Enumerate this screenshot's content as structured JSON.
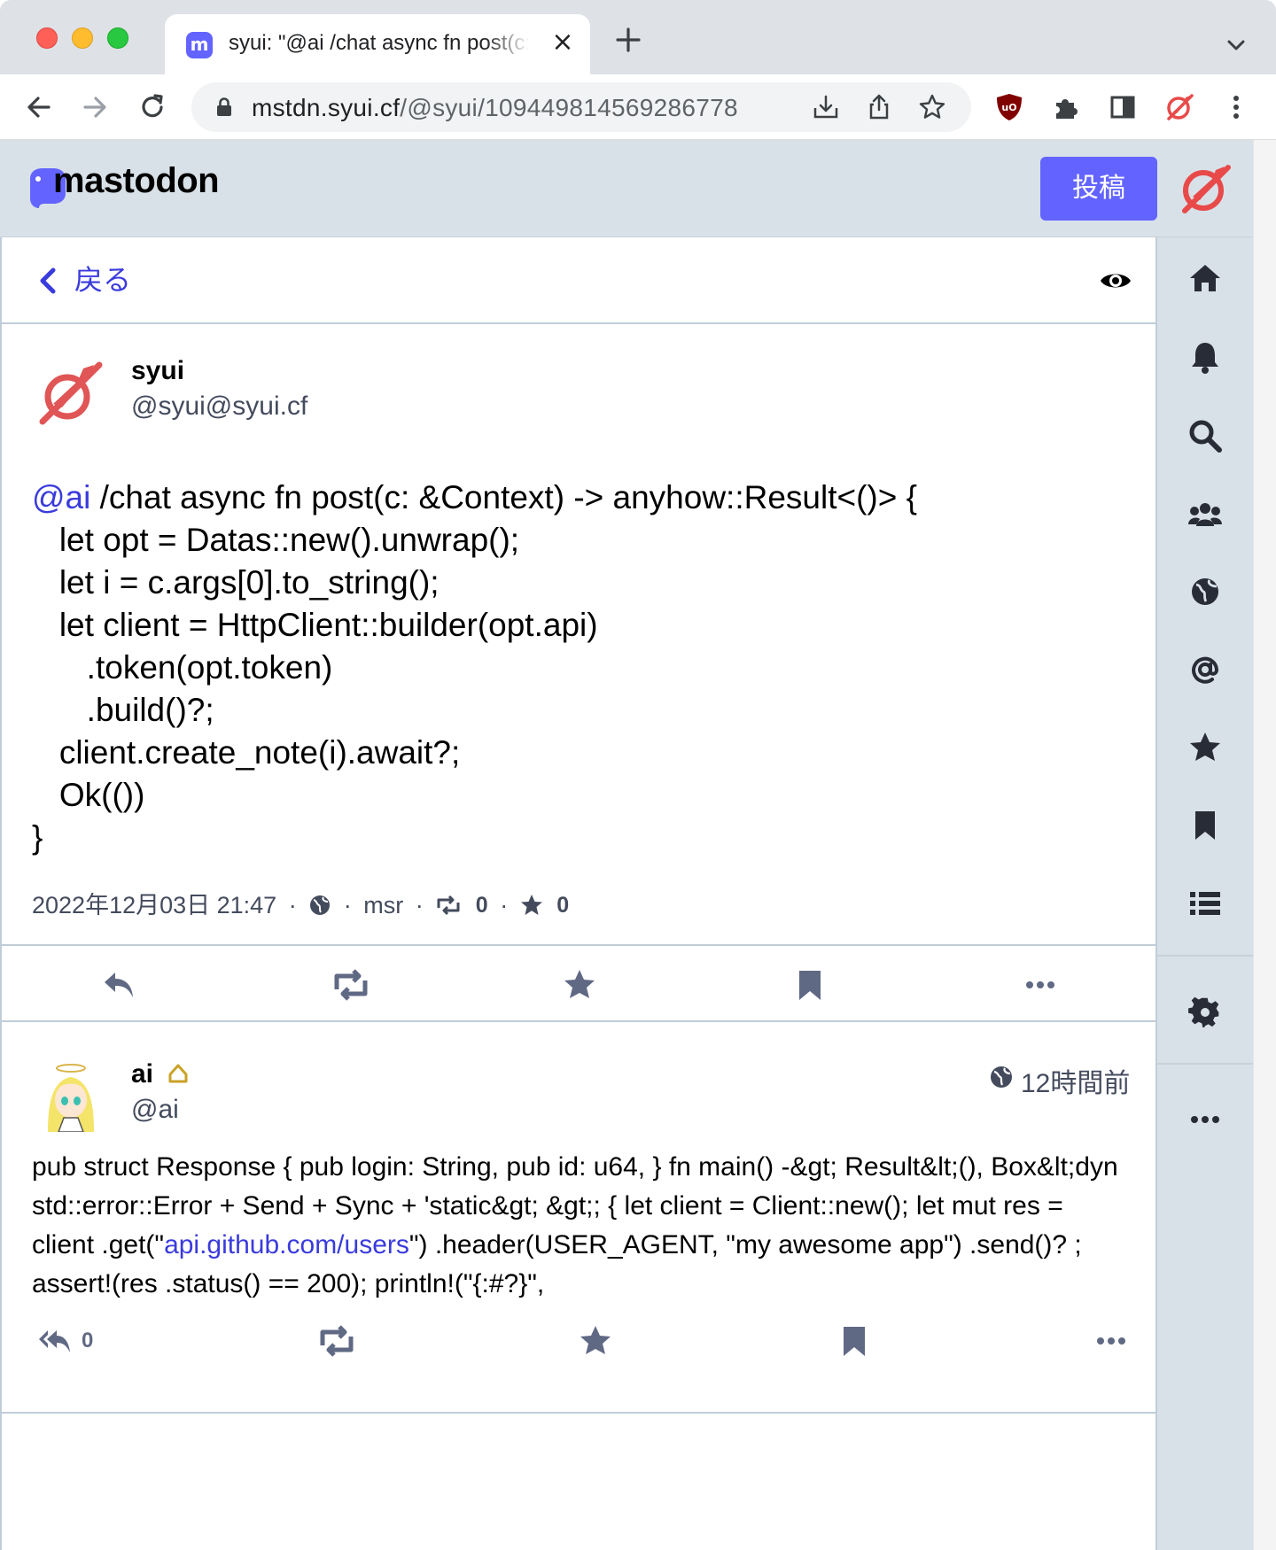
{
  "browser": {
    "tab_title": "syui: \"@ai /chat async fn post(c: &Context)",
    "url_host": "mstdn.syui.cf",
    "url_path": "/@syui/109449814569286778"
  },
  "app": {
    "brand": "mastodon",
    "post_button": "投稿"
  },
  "column": {
    "back_label": "戻る"
  },
  "main_status": {
    "display_name": "syui",
    "account": "@syui@syui.cf",
    "mention": "@ai",
    "content_lines": [
      " /chat async fn post(c: &Context) -> anyhow::Result<()> {",
      "   let opt = Datas::new().unwrap();",
      "   let i = c.args[0].to_string();",
      "   let client = HttpClient::builder(opt.api)",
      "      .token(opt.token)",
      "      .build()?;",
      "   client.create_note(i).await?;",
      "   Ok(())",
      "}"
    ],
    "date": "2022年12月03日 21:47",
    "app_name": "msr",
    "boost_count": "0",
    "fav_count": "0"
  },
  "reply_status": {
    "display_name": "ai",
    "account": "@ai",
    "time": "12時間前",
    "content_before_link": "pub struct Response {     pub login: String,     pub id: u64, } fn main() -&gt; Result&lt;(), Box&lt;dyn std::error::Error + Send + Sync + 'static&gt; &gt;; { let client = Client::new(); let mut res = client .get(\"",
    "content_link": "api.github.com/users",
    "content_after_link": "\") .header(USER_AGENT, \"my awesome app\") .send()? ; assert!(res .status() == 200); println!(\"{:#?}\",",
    "reply_count": "0"
  },
  "colors": {
    "accent": "#6364ff",
    "link": "#3a3bdc",
    "muted_icon": "#606984",
    "rail_icon": "#282c37"
  },
  "icons": {
    "nav": [
      "home-icon",
      "bell-icon",
      "search-icon",
      "people-icon",
      "globe-icon",
      "at-icon",
      "star-icon",
      "bookmark-icon",
      "list-icon",
      "gear-icon",
      "ellipsis-icon"
    ]
  }
}
